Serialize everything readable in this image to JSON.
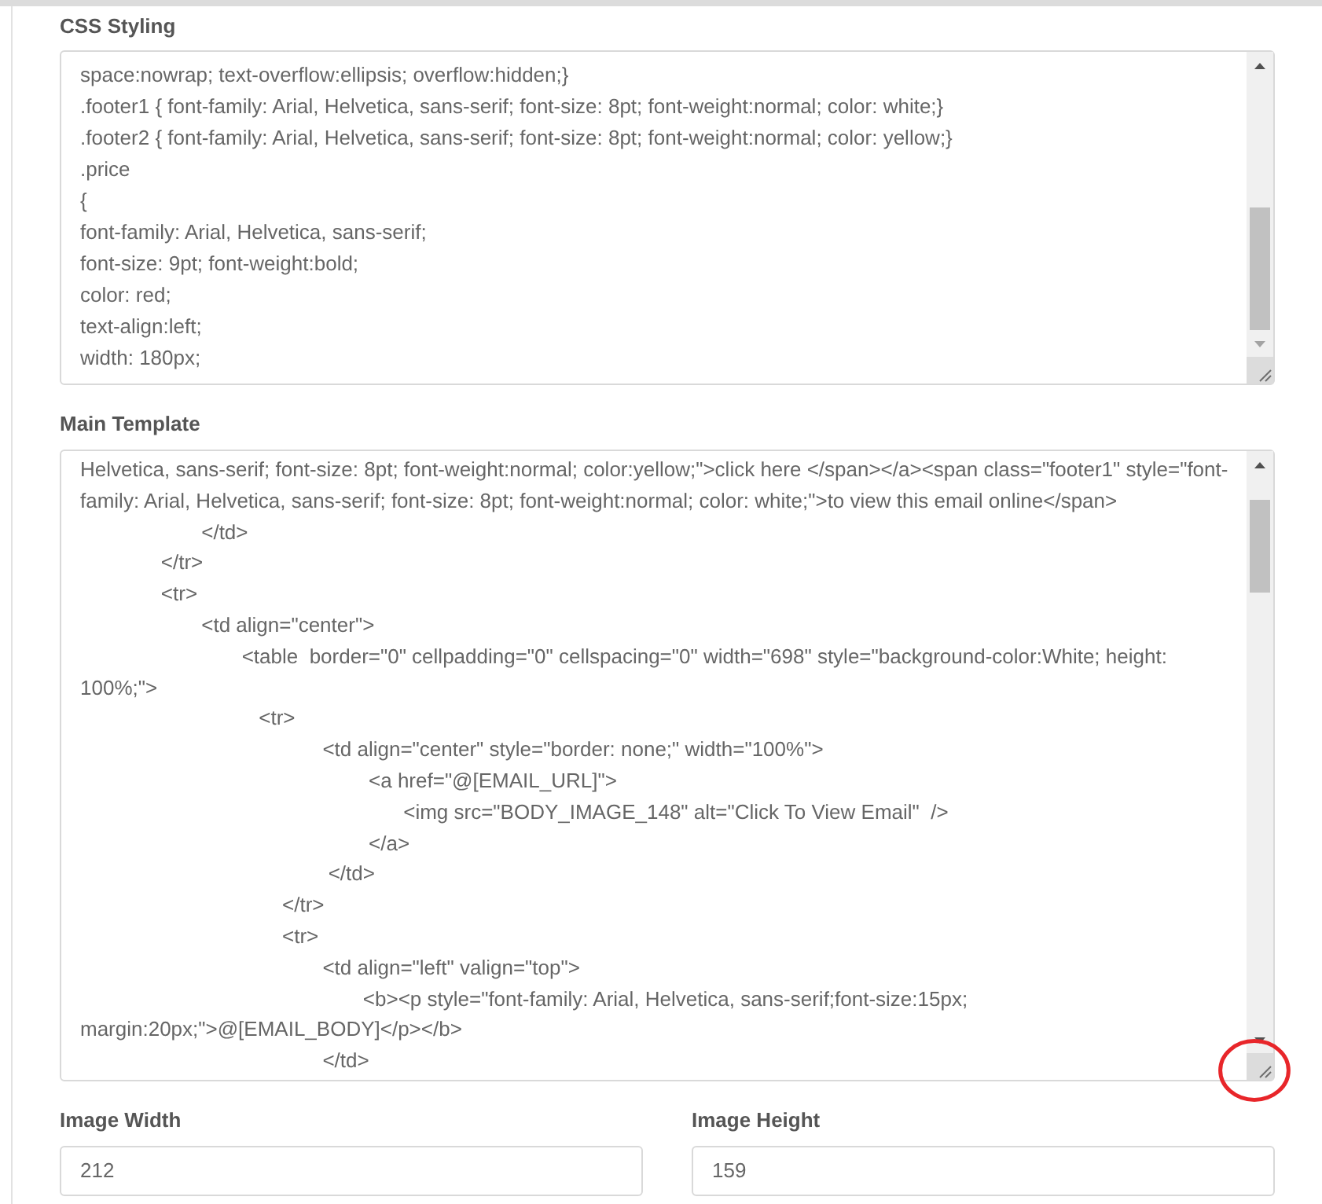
{
  "text_areas": [
    {
      "label": "CSS Styling",
      "resize_handle_circled": false,
      "lines": [
        "space:nowrap; text-overflow:ellipsis; overflow:hidden;}",
        ".footer1 { font-family: Arial, Helvetica, sans-serif; font-size: 8pt; font-weight:normal; color: white;}",
        ".footer2 { font-family: Arial, Helvetica, sans-serif; font-size: 8pt; font-weight:normal; color: yellow;}",
        ".price",
        "{",
        "font-family: Arial, Helvetica, sans-serif;",
        "font-size: 9pt; font-weight:bold;",
        "color: red;",
        "text-align:left;",
        "width: 180px;"
      ]
    },
    {
      "label": "Main Template",
      "resize_handle_circled": true,
      "lines": [
        "Helvetica, sans-serif; font-size: 8pt; font-weight:normal; color:yellow;\">click here </span></a><span class=\"footer1\" style=\"font-",
        "family: Arial, Helvetica, sans-serif; font-size: 8pt; font-weight:normal; color: white;\">to view this email online</span>",
        "\t\t\t</td>",
        "\t\t</tr>",
        "\t\t<tr>",
        "\t\t\t<td align=\"center\">",
        "\t\t\t\t<table  border=\"0\" cellpadding=\"0\" cellspacing=\"0\" width=\"698\" style=\"background-color:White; height:",
        "100%;\">",
        "\t\t\t\t   <tr>",
        "\t\t\t\t\t\t<td align=\"center\" style=\"border: none;\" width=\"100%\">",
        "\t\t\t\t\t\t\t <a href=\"@[EMAIL_URL]\">",
        "\t\t\t\t\t\t\t\t<img src=\"BODY_IMAGE_148\" alt=\"Click To View Email\"  />",
        "\t\t\t\t\t\t\t </a>",
        "\t\t\t\t\t\t </td>",
        "\t\t\t\t\t</tr>",
        "\t\t\t\t\t<tr>",
        "\t\t\t\t\t\t<td align=\"left\" valign=\"top\">",
        "\t\t\t\t\t\t\t<b><p style=\"font-family: Arial, Helvetica, sans-serif;font-size:15px;",
        "margin:20px;\">@[EMAIL_BODY]</p></b>",
        "\t\t\t\t\t\t</td>"
      ]
    }
  ],
  "dimension_fields": [
    {
      "label": "Image Width",
      "value": "212"
    },
    {
      "label": "Image Height",
      "value": "159"
    }
  ]
}
